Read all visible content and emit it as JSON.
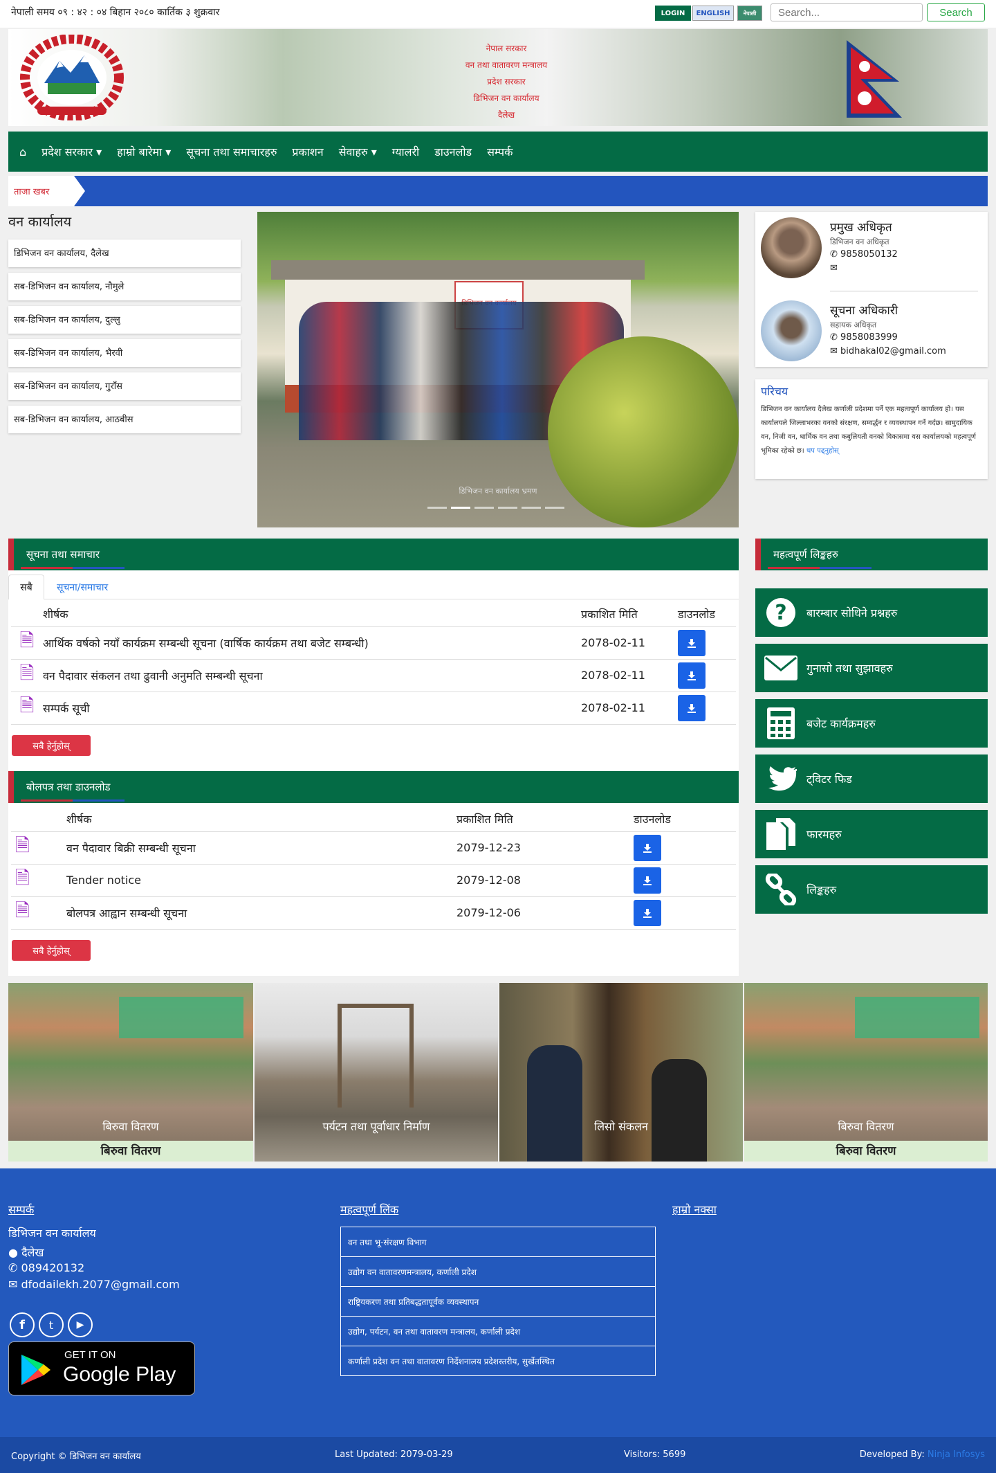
{
  "topbar": {
    "time": "नेपाली समय ०९ : ४२ : ०४ बिहान २०८० कार्तिक ३ शुक्रवार",
    "login": "LOGIN",
    "english": "ENGLISH",
    "nepali": "नेपाली",
    "search_placeholder": "Search...",
    "search_button": "Search"
  },
  "banner": {
    "lines": [
      "नेपाल सरकार",
      "वन तथा वातावरण मन्त्रालय",
      "प्रदेश सरकार",
      "डिभिजन वन कार्यालय",
      "दैलेख"
    ]
  },
  "nav": {
    "home_icon": "home-icon",
    "items": [
      "प्रदेश सरकार ▾",
      "हाम्रो बारेमा ▾",
      "सूचना तथा समाचारहरु",
      "प्रकाशन",
      "सेवाहरु ▾",
      "ग्यालरी",
      "डाउनलोड",
      "सम्पर्क"
    ]
  },
  "ticker": {
    "label": "ताजा खबर"
  },
  "offices": {
    "title": "वन कार्यालय",
    "items": [
      "डिभिजन वन कार्यालय, दैलेख",
      "सब-डिभिजन वन कार्यालय, नौमुले",
      "सब-डिभिजन वन कार्यालय, दुल्लु",
      "सब-डिभिजन वन कार्यालय, भैरवी",
      "सब-डिभिजन वन कार्यालय, गुराँस",
      "सब-डिभिजन वन कार्यालय, आठबीस"
    ]
  },
  "slider": {
    "caption": "डिभिजन वन कार्यालय भ्रमण",
    "sign_text": "डिभिजन वन कार्यालय"
  },
  "staff": [
    {
      "name": "प्रमुख अधिकृत",
      "role": "डिभिजन वन अधिकृत",
      "phone": "9858050132",
      "email": ""
    },
    {
      "name": "सूचना अधिकारी",
      "role": "सहायक अधिकृत",
      "phone": "9858083999",
      "email": "bidhakal02@gmail.com"
    }
  ],
  "intro": {
    "title": "परिचय",
    "text": "डिभिजन वन कार्यालय दैलेख कर्णाली प्रदेशमा पर्ने एक महत्वपूर्ण कार्यालय हो। यस कार्यालयले जिल्लाभरका वनको संरक्षण, सम्वर्द्धन र व्यवस्थापन गर्ने गर्दछ। सामुदायिक वन, निजी वन, धार्मिक वन तथा कबुलियती वनको विकासमा यस कार्यालयको महत्वपूर्ण भूमिका रहेको छ।",
    "more": "थप पढ्नुहोस्"
  },
  "notices": {
    "title": "सूचना तथा समाचार",
    "tabs": [
      "सबै",
      "सूचना/समाचार"
    ],
    "headers": [
      "शीर्षक",
      "प्रकाशित मिति",
      "डाउनलोड"
    ],
    "rows": [
      {
        "title": "आर्थिक वर्षको नयाँ कार्यक्रम सम्बन्धी सूचना (वार्षिक कार्यक्रम तथा बजेट सम्बन्धी)",
        "date": "2078-02-11"
      },
      {
        "title": "वन पैदावार संकलन तथा ढुवानी अनुमति सम्बन्धी सूचना",
        "date": "2078-02-11"
      },
      {
        "title": "सम्पर्क सूची",
        "date": "2078-02-11"
      }
    ],
    "all_btn": "सबै हेर्नुहोस्"
  },
  "downloads": {
    "title": "बोलपत्र तथा डाउनलोड",
    "headers": [
      "शीर्षक",
      "प्रकाशित मिति",
      "डाउनलोड"
    ],
    "rows": [
      {
        "title": "वन पैदावार बिक्री सम्बन्धी सूचना",
        "date": "2079-12-23"
      },
      {
        "title": "Tender notice",
        "date": "2079-12-08"
      },
      {
        "title": "बोलपत्र आह्वान सम्बन्धी सूचना",
        "date": "2079-12-06"
      }
    ],
    "all_btn": "सबै हेर्नुहोस्"
  },
  "services": {
    "title": "महत्वपूर्ण लिङ्कहरु",
    "items": [
      {
        "icon": "question-icon",
        "label": "बारम्बार सोधिने प्रश्नहरु"
      },
      {
        "icon": "envelope-icon",
        "label": "गुनासो तथा सुझावहरु"
      },
      {
        "icon": "calculator-icon",
        "label": "बजेट कार्यक्रमहरु"
      },
      {
        "icon": "twitter-icon",
        "label": "ट्विटर फिड"
      },
      {
        "icon": "document-icon",
        "label": "फारमहरु"
      },
      {
        "icon": "link-icon",
        "label": "लिङ्कहरु"
      }
    ]
  },
  "gallery": [
    {
      "caption": "बिरुवा वितरण",
      "sub": "बिरुवा वितरण"
    },
    {
      "caption": "पर्यटन तथा पूर्वाधार निर्माण",
      "sub": ""
    },
    {
      "caption": "लिसो संकलन",
      "sub": ""
    },
    {
      "caption": "बिरुवा वितरण",
      "sub": "बिरुवा वितरण"
    }
  ],
  "footer": {
    "contact_title": "सम्पर्क",
    "org": "डिभिजन वन कार्यालय",
    "address": "दैलेख",
    "phone": "089420132",
    "email": "dfodailekh.2077@gmail.com",
    "play_line1": "GET IT ON",
    "play_line2": "Google Play",
    "links_title": "महत्वपूर्ण लिंक",
    "links": [
      "वन तथा भू-संरक्षण विभाग",
      "उद्योग वन वातावरणमन्त्रालय, कर्णाली प्रदेश",
      "राष्ट्रियकरण तथा प्रतिबद्धतापूर्वक व्यवस्थापन",
      "उद्योग, पर्यटन, वन तथा वातावरण मन्त्रालय, कर्णाली प्रदेश",
      "कर्णाली प्रदेश वन तथा वातावरण निर्देशनालय प्रदेशस्तरीय, सुर्खेतस्थित"
    ],
    "map_title": "हाम्रो नक्सा"
  },
  "copyright": {
    "text": "Copyright © डिभिजन वन कार्यालय",
    "updated": "Last Updated: 2079-03-29",
    "visitors": "Visitors: 5699",
    "developed": "Developed By:",
    "developer": "Ninja Infosys"
  }
}
